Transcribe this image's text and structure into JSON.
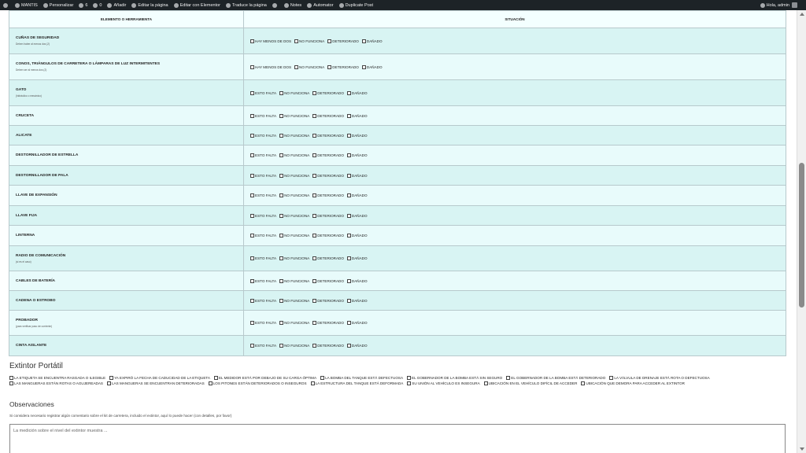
{
  "adminbar": {
    "items": [
      "MANTIS",
      "Personalizar",
      "6",
      "0",
      "Añadir",
      "Editar la página",
      "Editar con Elementor",
      "Traduce la página",
      "",
      "Notes",
      "Automator",
      "Duplicate Post"
    ],
    "greeting": "Hola, admin"
  },
  "table": {
    "headers": [
      "ELEMENTO O HERRAMIENTA",
      "SITUACIÓN"
    ],
    "rows": [
      {
        "name": "CUÑAS DE SEGURIDAD",
        "note": "Deben haber al menos dos (2)",
        "options": [
          "HAY MENOS DE DOS",
          "NO FUNCIONA",
          "DETERIORADO",
          "DAÑADO"
        ]
      },
      {
        "name": "CONOS, TRIÁNGULOS DE CARRETERA O LÁMPARAS DE LUZ INTERMITENTES",
        "note": "Deben ser al menos dos (2)",
        "options": [
          "HAY MENOS DE DOS",
          "NO FUNCIONA",
          "DETERIORADO",
          "DAÑADO"
        ]
      },
      {
        "name": "GATO",
        "note": "(hidráulico o mecánico)",
        "options": [
          "ESTO FALTA",
          "NO FUNCIONA",
          "DETERIORADO",
          "DAÑADO"
        ]
      },
      {
        "name": "CRUCETA",
        "note": "",
        "options": [
          "ESTO FALTA",
          "NO FUNCIONA",
          "DETERIORADO",
          "DAÑADO"
        ]
      },
      {
        "name": "ALICATE",
        "note": "",
        "options": [
          "ESTO FALTA",
          "NO FUNCIONA",
          "DETERIORADO",
          "DAÑADO"
        ]
      },
      {
        "name": "DESTORNILLADOR DE ESTRELLA",
        "note": "",
        "options": [
          "ESTO FALTA",
          "NO FUNCIONA",
          "DETERIORADO",
          "DAÑADO"
        ]
      },
      {
        "name": "DESTORNILLADOR DE PALA",
        "note": "",
        "options": [
          "ESTO FALTA",
          "NO FUNCIONA",
          "DETERIORADO",
          "DAÑADO"
        ]
      },
      {
        "name": "LLAVE DE EXPANSIÓN",
        "note": "",
        "options": [
          "ESTO FALTA",
          "NO FUNCIONA",
          "DETERIORADO",
          "DAÑADO"
        ]
      },
      {
        "name": "LLAVE FIJA",
        "note": "",
        "options": [
          "ESTO FALTA",
          "NO FUNCIONA",
          "DETERIORADO",
          "DAÑADO"
        ]
      },
      {
        "name": "LINTERNA",
        "note": "",
        "options": [
          "ESTO FALTA",
          "NO FUNCIONA",
          "DETERIORADO",
          "DAÑADO"
        ]
      },
      {
        "name": "RADIO DE COMUNICACIÓN",
        "note": "(si es el caso)",
        "options": [
          "ESTO FALTA",
          "NO FUNCIONA",
          "DETERIORADO",
          "DAÑADO"
        ]
      },
      {
        "name": "CABLES DE BATERÍA",
        "note": "",
        "options": [
          "ESTO FALTA",
          "NO FUNCIONA",
          "DETERIORADO",
          "DAÑADO"
        ]
      },
      {
        "name": "CADENA O ESTROBO",
        "note": "",
        "options": [
          "ESTO FALTA",
          "NO FUNCIONA",
          "DETERIORADO",
          "DAÑADO"
        ]
      },
      {
        "name": "PROBADOR",
        "note": "(para verificar paso de corriente)",
        "options": [
          "ESTO FALTA",
          "NO FUNCIONA",
          "DETERIORADO",
          "DAÑADO"
        ]
      },
      {
        "name": "CINTA AISLANTE",
        "note": "",
        "options": [
          "ESTO FALTA",
          "NO FUNCIONA",
          "DETERIORADO",
          "DAÑADO"
        ]
      }
    ]
  },
  "extintor": {
    "title": "Extintor Portátil",
    "options": [
      "LA ETIQUETA SE ENCUENTRA RASGADA O ILEGIBLE",
      "YA EXPIRÓ LA FECHA DE CADUCIDAD DE LA ETIQUETA",
      "EL MEDIDOR ESTÁ POR DEBAJO DE SU CARGA ÓPTIMA",
      "LA BOMBA DEL TANQUE ESTÁ DEFECTUOSA",
      "EL GOBERNADOR DE LA BOMBA ESTÁ SIN SEGURO",
      "EL GOBERNADOR DE LA BOMBA ESTÁ DETERIORADO",
      "LA VÁLVULA DE DRENAJE ESTÁ ROTA O DEFECTUOSA",
      "LAS MANGUERAS ESTÁN ROTAS O AGUJEREADAS",
      "LAS MANGUERAS SE ENCUENTRAN DETERIORADAS",
      "LOS PITONES ESTÁN DETERIORADOS O INSEGUROS",
      "LA ESTRUCTURA DEL TANQUE ESTÁ DEFORMADA",
      "SU UNIÓN AL VEHÍCULO ES INSEGURA",
      "UBICACIÓN EN EL VEHÍCULO DIFÍCIL DE ACCEDER",
      "UBICACIÓN QUE DEMORA PARA ACCEDER AL EXTINTOR"
    ]
  },
  "observaciones": {
    "title": "Observaciones",
    "description": "Si considera necesario registrar algún comentario sobre el kit de carretera, incluido el extintor, aquí lo puede hacer (con detalles, por favor)",
    "placeholder": "La medición sobre el nivel del extintor muestra ..."
  }
}
